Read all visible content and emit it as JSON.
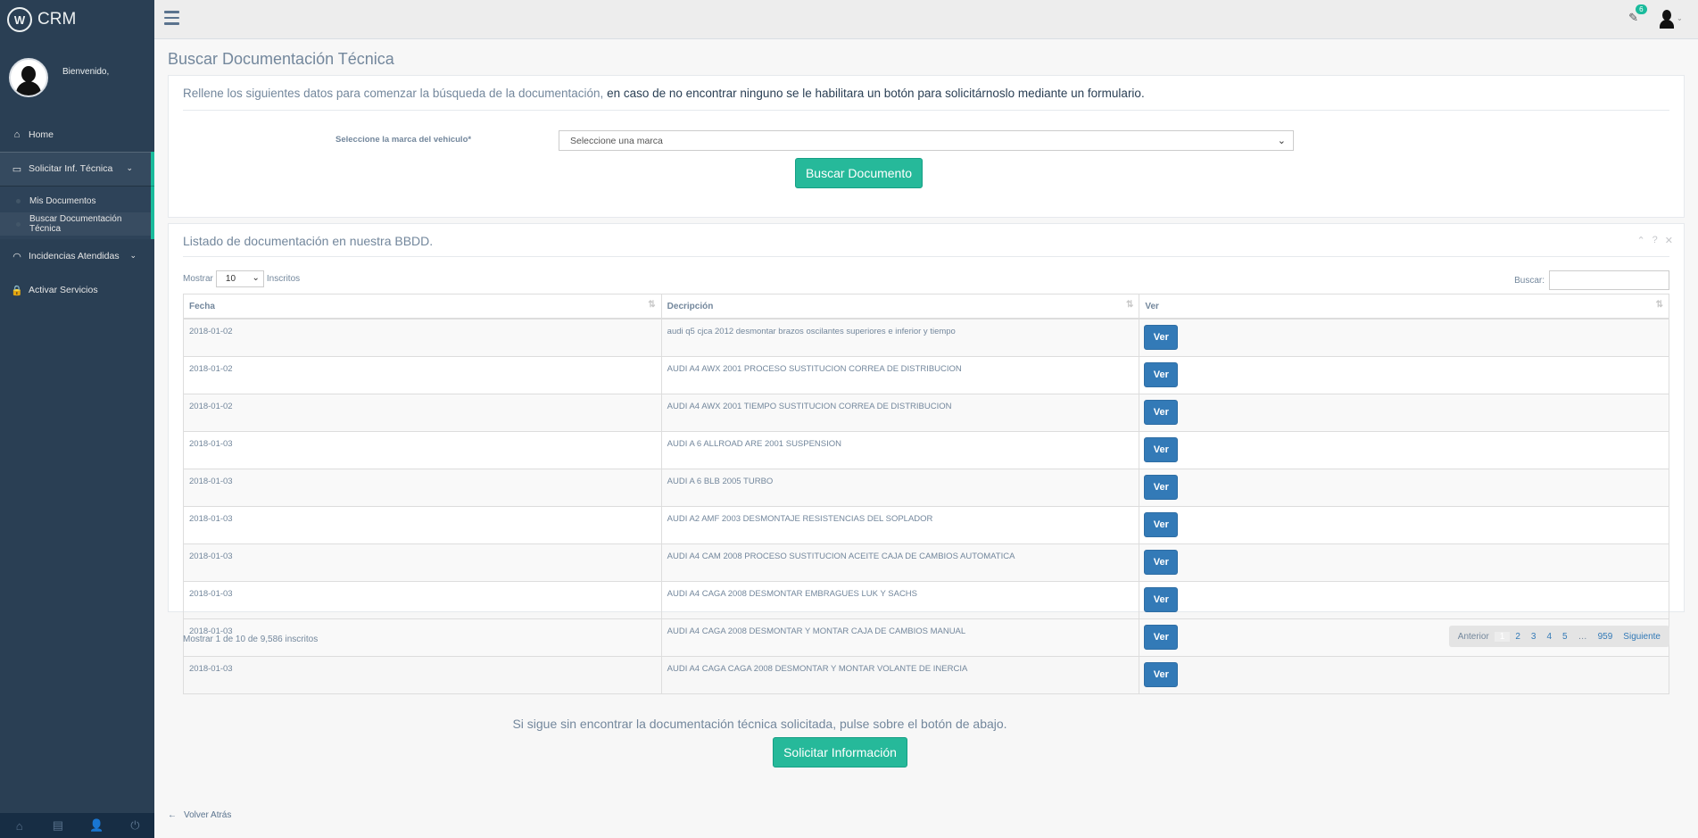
{
  "sidebar": {
    "brand": "CRM",
    "logo_letter": "W",
    "welcome": "Bienvenido,",
    "menu": {
      "home": "Home",
      "solicitar": "Solicitar Inf. Técnica",
      "sub_mis_documentos": "Mis Documentos",
      "sub_buscar": "Buscar Documentación Técnica",
      "incidencias": "Incidencias Atendidas",
      "activar": "Activar Servicios"
    },
    "icons": {
      "home": "⌂",
      "monitor": "▭",
      "headset": "◠",
      "lock": "🔒",
      "chevron": "⌄"
    },
    "footer_icons": [
      "⌂",
      "▤",
      "👤",
      "⏻"
    ]
  },
  "topnav": {
    "notification_count": "6",
    "notification_icon": "✎",
    "caret": "⌄"
  },
  "page": {
    "title": "Buscar Documentación Técnica",
    "intro_part1": "Rellene los siguientes datos para comenzar la búsqueda de la documentación,",
    "intro_part2": " en caso de no encontrar ninguno se le habilitara un botón para solicitárnoslo mediante un formulario.",
    "brand_label": "Seleccione la marca del vehiculo*",
    "brand_select_value": "Seleccione una marca",
    "search_button": "Buscar Documento"
  },
  "listing": {
    "title": "Listado de documentación en nuestra BBDD.",
    "tools": [
      "⌃",
      "?",
      "✕"
    ],
    "show_label": "Mostrar",
    "length_value": "10",
    "entries_label": "Inscritos",
    "search_label": "Buscar:",
    "columns": [
      "Fecha",
      "Decripción",
      "Ver"
    ],
    "sort_icon": "⇅",
    "view_label": "Ver",
    "rows": [
      {
        "fecha": "2018-01-02",
        "descripcion": "audi q5 cjca 2012 desmontar brazos oscilantes superiores e inferior y tiempo"
      },
      {
        "fecha": "2018-01-02",
        "descripcion": "AUDI A4 AWX 2001 PROCESO SUSTITUCION CORREA DE DISTRIBUCION"
      },
      {
        "fecha": "2018-01-02",
        "descripcion": "AUDI A4 AWX 2001 TIEMPO SUSTITUCION CORREA DE DISTRIBUCION"
      },
      {
        "fecha": "2018-01-03",
        "descripcion": "AUDI A 6 ALLROAD ARE 2001 SUSPENSION"
      },
      {
        "fecha": "2018-01-03",
        "descripcion": "AUDI A 6 BLB 2005 TURBO"
      },
      {
        "fecha": "2018-01-03",
        "descripcion": "AUDI A2 AMF 2003 DESMONTAJE RESISTENCIAS DEL SOPLADOR"
      },
      {
        "fecha": "2018-01-03",
        "descripcion": "AUDI A4 CAM 2008 PROCESO SUSTITUCION ACEITE CAJA DE CAMBIOS AUTOMATICA"
      },
      {
        "fecha": "2018-01-03",
        "descripcion": "AUDI A4 CAGA 2008 DESMONTAR EMBRAGUES LUK Y SACHS"
      },
      {
        "fecha": "2018-01-03",
        "descripcion": "AUDI A4 CAGA 2008 DESMONTAR Y MONTAR CAJA DE CAMBIOS MANUAL"
      },
      {
        "fecha": "2018-01-03",
        "descripcion": "AUDI A4 CAGA CAGA 2008 DESMONTAR Y MONTAR VOLANTE DE INERCIA"
      }
    ],
    "info": "Mostrar 1 de 10 de 9,586 inscritos",
    "pagination": {
      "prev": "Anterior",
      "pages": [
        "1",
        "2",
        "3",
        "4",
        "5",
        "…",
        "959"
      ],
      "next": "Siguiente"
    }
  },
  "bottom": {
    "note": "Si sigue sin encontrar la documentación técnica solicitada, pulse sobre el botón de abajo.",
    "request_button": "Solicitar Información",
    "back_icon": "←",
    "back_link": "Volver Atrás"
  },
  "colors": {
    "sidebar": "#2A3F54",
    "accent_green": "#26B99A",
    "button_blue": "#337AB7",
    "text": "#73879C"
  }
}
